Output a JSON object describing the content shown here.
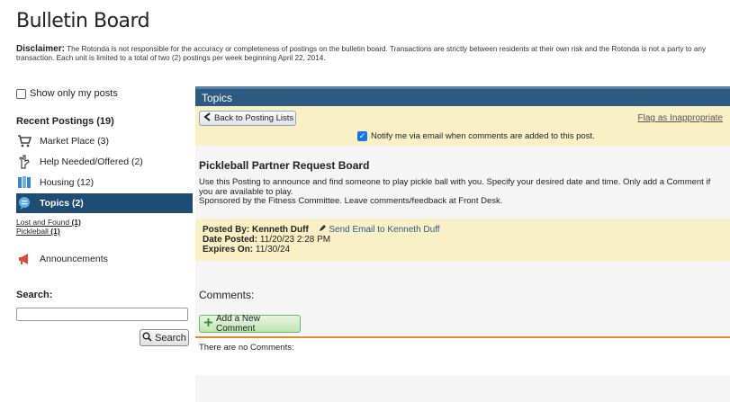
{
  "page": {
    "title": "Bulletin Board",
    "disclaimer_label": "Disclaimer:",
    "disclaimer_text": "The Rotonda is not responsible for the accuracy or completeness of postings on the bulletin board. Transactions are strictly between residents at their own risk and the Rotonda is not a party to any transaction. Each unit is limited to a total of two (2) postings per week beginning April 22, 2014."
  },
  "sidebar": {
    "show_mine_label": "Show only my posts",
    "recent_title": "Recent Postings (19)",
    "items": [
      {
        "label": "Market Place (3)",
        "icon": "cart-icon"
      },
      {
        "label": "Help Needed/Offered (2)",
        "icon": "hand-icon"
      },
      {
        "label": "Housing (12)",
        "icon": "map-icon"
      },
      {
        "label": "Topics (2)",
        "icon": "chat-icon"
      },
      {
        "label": "Announcements",
        "icon": "megaphone-icon"
      }
    ],
    "sublinks": [
      "Lost and Found",
      "Pickleball"
    ],
    "sublink_counts": [
      "(1)",
      "(1)"
    ],
    "search_label": "Search:",
    "search_button": "Search"
  },
  "main": {
    "header": "Topics",
    "back_button": "Back to Posting Lists",
    "flag_link": "Flag as Inappropriate",
    "notify_label": "Notify me via email when comments are added to this post.",
    "post_title": "Pickleball Partner Request Board",
    "post_body_1": "Use this Posting to announce and find someone to play pickle ball with you.  Specify your desired date and time.  Only add a Comment if you are available to play.",
    "post_body_2": "Sponsored by the Fitness Committee.  Leave comments/feedback at Front Desk.",
    "posted_by_label": "Posted By:",
    "posted_by": "Kenneth Duff",
    "send_email": "Send Email to Kenneth Duff",
    "date_posted_label": "Date Posted:",
    "date_posted": "11/20/23 2:28 PM",
    "expires_label": "Expires On:",
    "expires": "11/30/24",
    "comments_label": "Comments:",
    "add_comment": "Add a New Comment",
    "no_comments": "There are no Comments:"
  },
  "colors": {
    "header_bar": "#2c5a80",
    "active_item": "#1f4c72",
    "highlight": "#faf0c6",
    "divider": "#e58a2b"
  }
}
